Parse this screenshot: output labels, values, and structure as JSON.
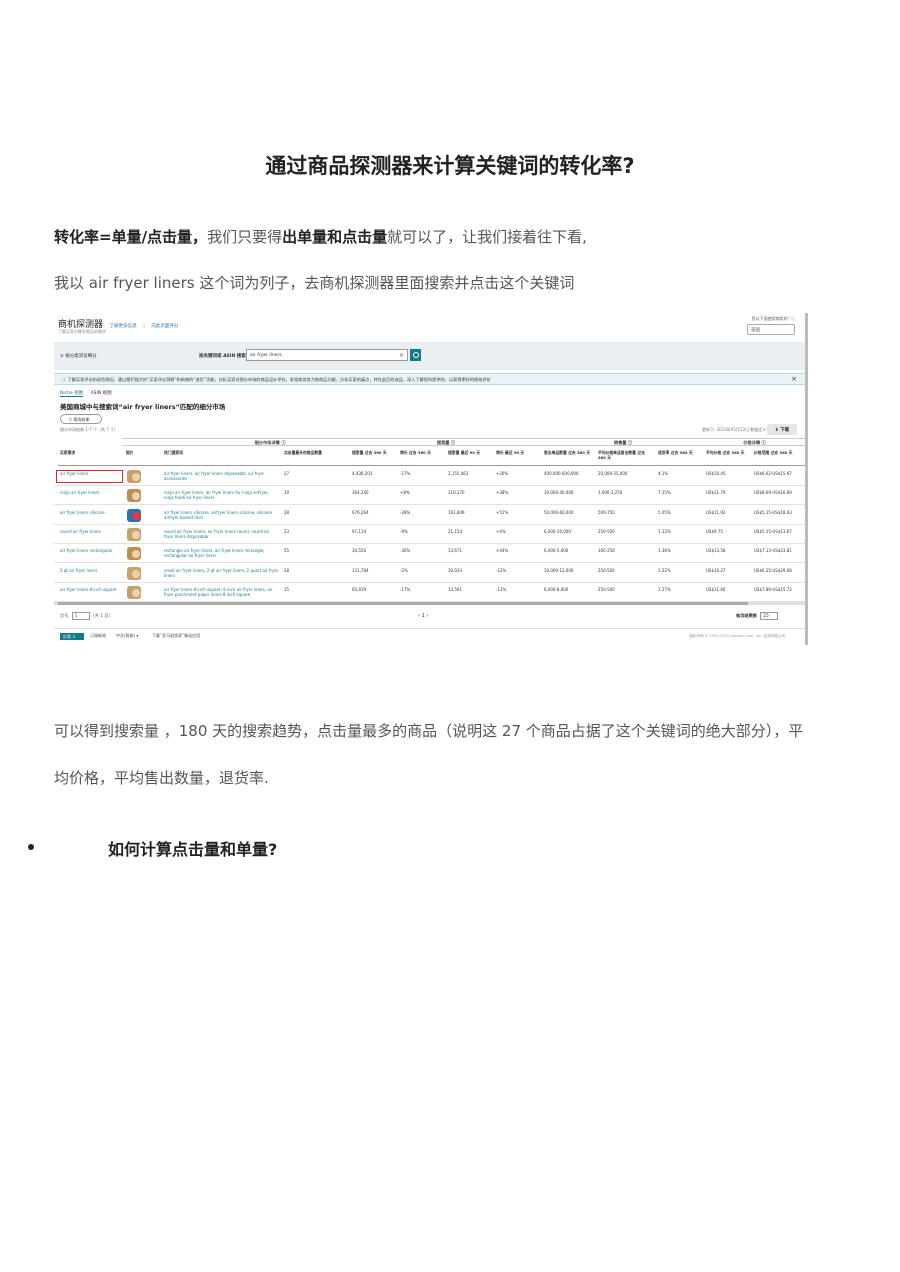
{
  "doc": {
    "title": "通过商品探测器来计算关键词的转化率?",
    "p1_bold_a": "转化率=单量/点击量，",
    "p1_text_a": "我们只要得",
    "p1_bold_b": "出单量和点击量",
    "p1_text_b": "就可以了，让我们接着往下看,",
    "p2": "我以 air fryer liners  这个词为列子，去商机探测器里面搜索并点击这个关键词",
    "p3": "可以得到搜索量 ，180 天的搜索趋势，点击量最多的商品（说明这 27 个商品占据了这个关键词的绝大部分），平",
    "p4": "均价格，平均售出数量，退货率.",
    "bullet": "如何计算点击量和单量?"
  },
  "shot": {
    "title": "商机探测器",
    "link1": "了解更多信息",
    "sep": "|",
    "link2": "向此页面评分",
    "subtitle": "了解买家对哪些商品的需求",
    "region_label": "您以下面使用商机的“ ⓘ",
    "region_value": "美国",
    "menu": "≡  按分类浏览细分",
    "search_label": "按关键词或 ASIN 搜索",
    "search_value": "air fryer liners",
    "info": "ⓘ 了解买家评论和退货原因，通过我们强大的“买家评论洞察”和新增的“退货”功能，分析买家对细分市场的商品设计评价。发现商务势力和商品功能，分析买家的痛点，并在此后的选品、深入了解您所提供的，以获得更好的绩效评价",
    "info_close": "×",
    "tab_active": "Niche 视图",
    "tab_other": "ASIN 视图",
    "market_title": "美国商城中与搜索词“air fryer liners”匹配的细分市场",
    "filter": "▽  筛选结果",
    "count": "细分市场结果 1-7 个（共 7 个）",
    "updated": "更新于: 2023年05月13日     数据定义",
    "download": "⬇ 下载",
    "groups": [
      "细分市场详情 ⓘ",
      "搜索量 ⓘ",
      "销售量 ⓘ",
      "价格详情 ⓘ"
    ],
    "columns": [
      "买家需求",
      "图片",
      "热门搜索词",
      "点击量最多的商品数量",
      "搜索量 过去 360 天",
      "增长 过去 360 天",
      "搜索量 最近 90 天",
      "增长 最近 90 天",
      "售出单品数量 过去 360 天",
      "平均价格单品售出数量 过去 360 天",
      "退货率 过去 360 天",
      "平均价格 过去 360 天",
      "价格范围 过去 360 天"
    ],
    "rows": [
      {
        "need": "air fryer liners",
        "terms": "air fryer liners, air fryer liners disposable, air fryer accessories",
        "products": "27",
        "sv360": "4,436,203",
        "g360": "-17%",
        "sv90": "2,155,463",
        "g90": "+20%",
        "units": "400,000-600,000",
        "avgunits": "20,000-25,000",
        "ret": "4.1%",
        "avgprice": "US$10.45",
        "range": "US$6.62-US$15.67"
      },
      {
        "need": "ninja air fryer liners",
        "terms": "ninja air fryer liners, air fryer liners for ninja airfryer, ninja foodi air fryer liners",
        "products": "30",
        "sv360": "364,240",
        "g360": "+8%",
        "sv90": "110,170",
        "g90": "+38%",
        "units": "30,000-40,000",
        "avgunits": "1,000-1,250",
        "ret": "7.15%",
        "avgprice": "US$11.79",
        "range": "US$8.69-US$16.99"
      },
      {
        "need": "air fryer liners silicone",
        "terms": "air fryer liners silicone, airfryer liners silicone, silicone airfryer basket liner",
        "products": "28",
        "sv360": "676,264",
        "g360": "-28%",
        "sv90": "161,849",
        "g90": "+51%",
        "units": "50,000-60,000",
        "avgunits": "500-750",
        "ret": "5.05%",
        "avgprice": "US$11.92",
        "range": "US$5.15-US$18.03"
      },
      {
        "need": "round air fryer liners",
        "terms": "round air fryer liners, air fryer liners round, round air fryer liners disposable",
        "products": "23",
        "sv360": "97,114",
        "g360": "-9%",
        "sv90": "21,154",
        "g90": "+4%",
        "units": "6,000-10,000",
        "avgunits": "250-500",
        "ret": "1.12%",
        "avgprice": "US$9.75",
        "range": "US$5.15-US$13.67"
      },
      {
        "need": "air fryer liners rectangular",
        "terms": "rectangle air fryer liners, air fryer liners rectangle, rectangular air fryer liners",
        "products": "55",
        "sv360": "34,556",
        "g360": "-36%",
        "sv90": "13,671",
        "g90": "+44%",
        "units": "6,000-5,000",
        "avgunits": "100-250",
        "ret": "1.36%",
        "avgprice": "US$13.58",
        "range": "US$7.13-US$23.81"
      },
      {
        "need": "2 qt air fryer liners",
        "terms": "small air fryer liners, 2 qt air fryer liners, 2 quart air fryer liners",
        "products": "28",
        "sv360": "131,784",
        "g360": "-2%",
        "sv90": "30,033",
        "g90": "-12%",
        "units": "10,000-12,000",
        "avgunits": "250-500",
        "ret": "1.52%",
        "avgprice": "US$10.27",
        "range": "US$6.25-US$29.68"
      },
      {
        "need": "air fryer liners 8 inch square",
        "terms": "air fryer liners 8 inch square, 8 inch air fryer liners, air fryer parchment paper liners 8 inch square",
        "products": "15",
        "sv360": "65,819",
        "g360": "-17%",
        "sv90": "14,591",
        "g90": "-12%",
        "units": "6,000-8,000",
        "avgunits": "250-500",
        "ret": "1.27%",
        "avgprice": "US$11.66",
        "range": "US$7.89-US$15.72"
      }
    ],
    "page_label": "页号",
    "page_value": "1",
    "page_total": "(共 1 页)",
    "pages": "‹  1  ›",
    "perpage_label": "每页结果数",
    "perpage_value": "25",
    "feedback": "反馈 ×",
    "foot_a": "订阅新闻",
    "foot_b": "中文(简体) ▾",
    "foot_c": "下载“亚马逊卖家”移动应用",
    "copyright": "隐私声明 © 1999-2023 Amazon.com, Inc. 或其附属公司"
  }
}
